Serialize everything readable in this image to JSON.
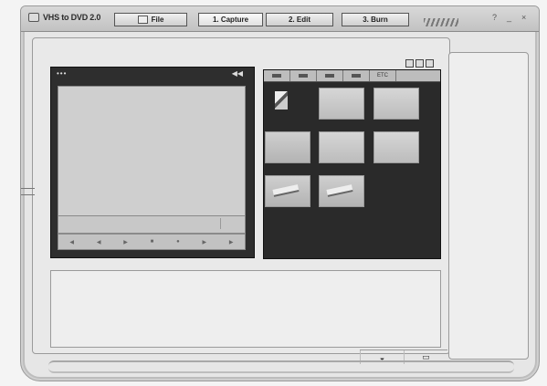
{
  "app": {
    "title": "VHS to DVD 2.0"
  },
  "tabs": {
    "file": "File",
    "capture": "1. Capture",
    "edit": "2. Edit",
    "burn": "3. Burn"
  },
  "window_controls": {
    "help": "?",
    "minimize": "_",
    "close": "×"
  },
  "preview": {
    "dots": "•••",
    "volume_icon": "speaker-icon"
  },
  "clip_toolbar": {
    "last_label": "ETC"
  },
  "icons": [
    "logo-icon",
    "folder-icon",
    "speaker-icon",
    "view-grid-icon",
    "view-list-icon",
    "camera-icon",
    "window-icon"
  ],
  "colors": {
    "panel_dark": "#2a2a2a",
    "background": "#e6e6e6"
  }
}
